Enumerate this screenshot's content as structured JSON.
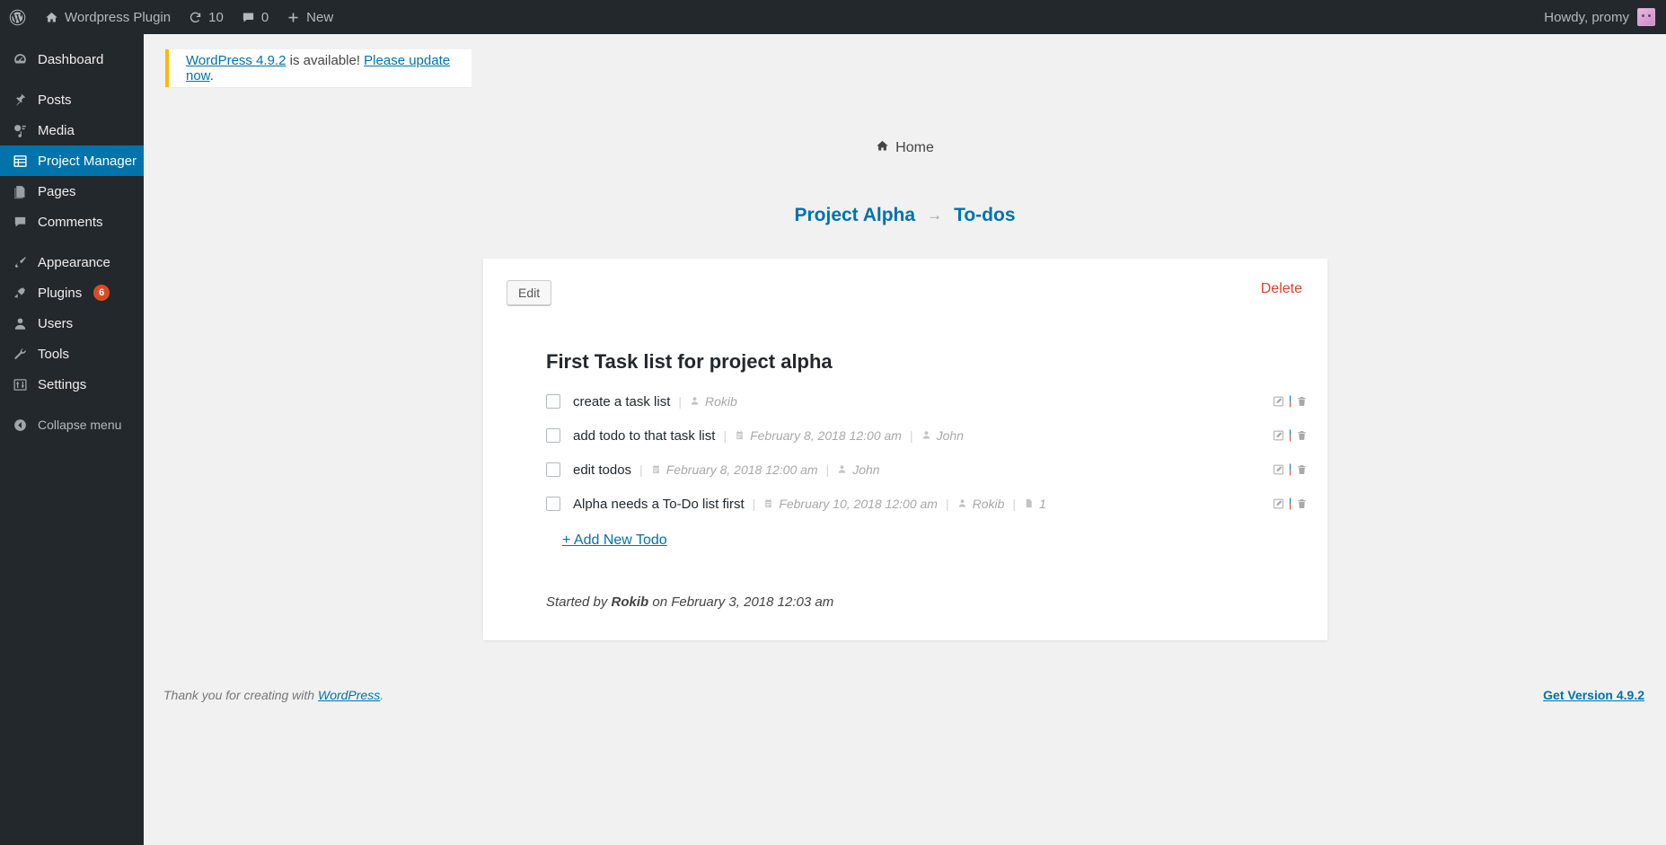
{
  "adminbar": {
    "logo_icon": "wordpress-logo-icon",
    "site_name": "Wordpress Plugin",
    "site_icon": "home-icon",
    "updates": {
      "icon": "updates-icon",
      "count": "10"
    },
    "comments": {
      "icon": "comment-bubble-icon",
      "count": "0"
    },
    "new": {
      "icon": "plus-icon",
      "label": "New"
    },
    "howdy": "Howdy, promy",
    "avatar_icon": "user-avatar"
  },
  "sidebar": {
    "items": [
      {
        "label": "Dashboard",
        "icon": "dashboard-icon",
        "active": false
      },
      {
        "label": "Posts",
        "icon": "pin-icon",
        "active": false
      },
      {
        "label": "Media",
        "icon": "media-icon",
        "active": false
      },
      {
        "label": "Project Manager",
        "icon": "grid-table-icon",
        "active": true
      },
      {
        "label": "Pages",
        "icon": "pages-icon",
        "active": false
      },
      {
        "label": "Comments",
        "icon": "comment-icon",
        "active": false
      },
      {
        "label": "Appearance",
        "icon": "brush-icon",
        "active": false
      },
      {
        "label": "Plugins",
        "icon": "plug-icon",
        "active": false,
        "badge": "6"
      },
      {
        "label": "Users",
        "icon": "user-icon",
        "active": false
      },
      {
        "label": "Tools",
        "icon": "wrench-icon",
        "active": false
      },
      {
        "label": "Settings",
        "icon": "sliders-icon",
        "active": false
      }
    ],
    "collapse": {
      "label": "Collapse menu",
      "icon": "collapse-arrow-icon"
    }
  },
  "notice": {
    "version_link": "WordPress 4.9.2",
    "middle_text": " is available! ",
    "update_link": "Please update now",
    "trailing": ".",
    "accent_color": "#ffb900"
  },
  "breadcrumb": {
    "home": "Home",
    "home_icon": "home-icon",
    "project": "Project Alpha",
    "separator": "→",
    "section": "To-dos"
  },
  "card": {
    "edit_label": "Edit",
    "delete_label": "Delete",
    "delete_color": "#d9432f",
    "list_title": "First Task list for project alpha",
    "add_new_label": "+ Add New Todo",
    "started_prefix": "Started by ",
    "started_user": "Rokib",
    "started_suffix": " on February 3, 2018 12:03 am",
    "todos": [
      {
        "title": "create a task list",
        "date": "",
        "user": "Rokib",
        "files": "",
        "checked": false
      },
      {
        "title": "add todo to that task list",
        "date": "February 8, 2018 12:00 am",
        "user": "John",
        "files": "",
        "checked": false
      },
      {
        "title": "edit todos",
        "date": "February 8, 2018 12:00 am",
        "user": "John",
        "files": "",
        "checked": false
      },
      {
        "title": "Alpha needs a To-Do list first",
        "date": "February 10, 2018 12:00 am",
        "user": "Rokib",
        "files": "1",
        "checked": false
      }
    ],
    "row_icons": {
      "calendar": "calendar-icon",
      "user": "user-icon",
      "file": "document-icon",
      "edit": "pencil-edit-icon",
      "delete": "trash-icon"
    }
  },
  "footer": {
    "thanks_prefix": "Thank you for creating with ",
    "wordpress_link": "WordPress",
    "thanks_suffix": ".",
    "version_link": "Get Version 4.9.2"
  }
}
